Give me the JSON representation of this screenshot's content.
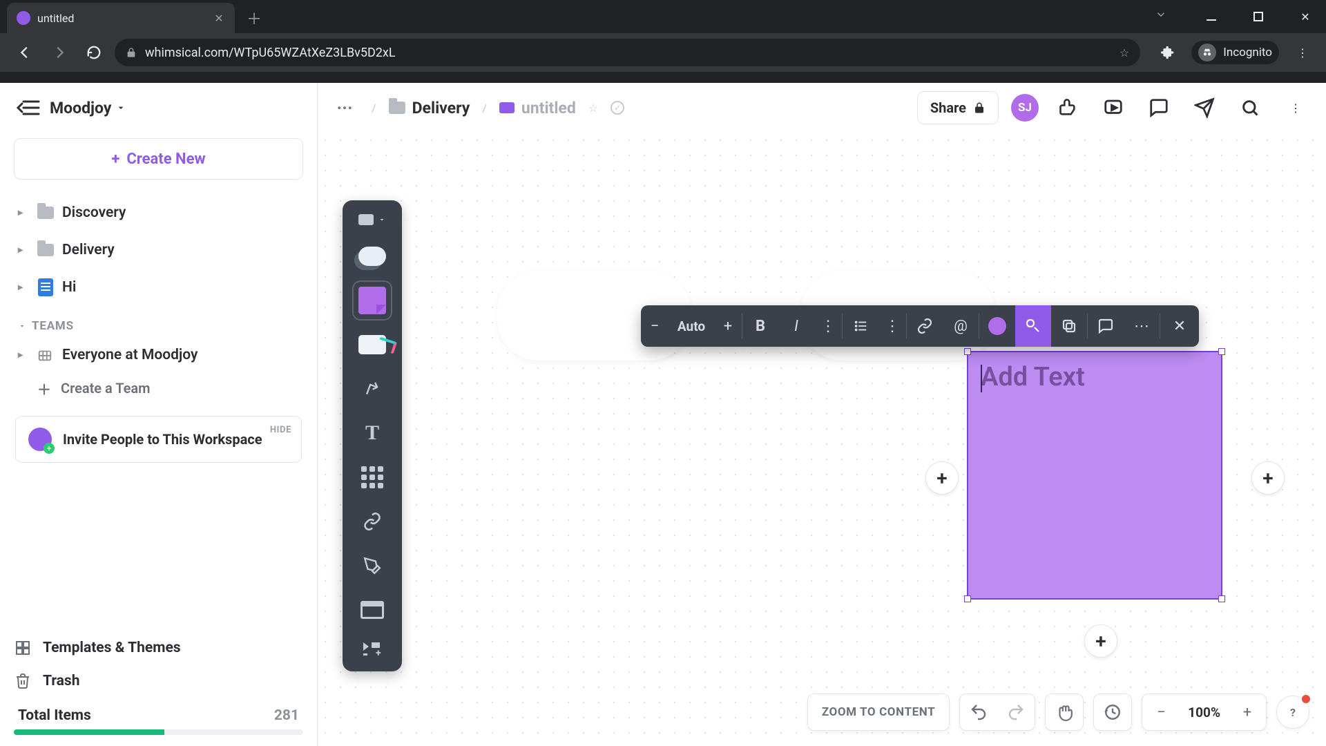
{
  "browser": {
    "tab_title": "untitled",
    "url": "whimsical.com/WTpU65WZAtXeZ3LBv5D2xL",
    "incognito_label": "Incognito"
  },
  "workspace": {
    "name": "Moodjoy"
  },
  "sidebar": {
    "create_new": "Create New",
    "items": [
      {
        "label": "Discovery",
        "type": "folder"
      },
      {
        "label": "Delivery",
        "type": "folder"
      },
      {
        "label": "Hi",
        "type": "doc"
      }
    ],
    "teams_caption": "TEAMS",
    "teams": [
      {
        "label": "Everyone at Moodjoy"
      }
    ],
    "create_team": "Create a Team",
    "invite": {
      "text": "Invite People to This Workspace",
      "hide": "HIDE"
    },
    "templates": "Templates & Themes",
    "trash": "Trash",
    "total_label": "Total Items",
    "total_count": "281"
  },
  "breadcrumb": {
    "folder": "Delivery",
    "doc": "untitled"
  },
  "topbar": {
    "share": "Share",
    "avatar": "SJ"
  },
  "fmt": {
    "font_size_label": "Auto"
  },
  "note": {
    "placeholder": "Add Text"
  },
  "bottom": {
    "zoom_to_content": "ZOOM TO CONTENT",
    "zoom": "100%",
    "help": "?"
  }
}
